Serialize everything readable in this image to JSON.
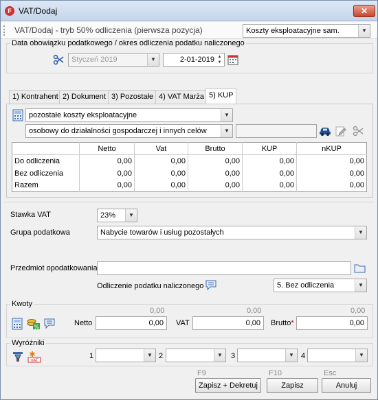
{
  "window": {
    "title": "VAT/Dodaj",
    "close_label": "✕"
  },
  "header": {
    "mode_text": "VAT/Dodaj - tryb 50% odliczenia (pierwsza pozycja)",
    "category_value": "Koszty eksploatacyjne sam."
  },
  "period": {
    "group_title": "Data obowiązku podatkowego / okres odliczenia podatku naliczonego",
    "month_value": "Styczeń 2019",
    "date_value": "2-01-2019"
  },
  "tabs": [
    {
      "label": "1) Kontrahent"
    },
    {
      "label": "2) Dokument"
    },
    {
      "label": "3) Pozostałe"
    },
    {
      "label": "4) VAT Marża"
    },
    {
      "label": "5) KUP"
    }
  ],
  "kup": {
    "category_value": "pozostałe koszty eksploatacyjne",
    "vehicle_type_value": "osobowy do działalności gospodarczej i innych celów",
    "vehicle_field_value": "",
    "grid": {
      "headers": [
        "",
        "Netto",
        "Vat",
        "Brutto",
        "KUP",
        "nKUP"
      ],
      "rows": [
        {
          "label": "Do odliczenia",
          "values": [
            "0,00",
            "0,00",
            "0,00",
            "0,00",
            "0,00"
          ]
        },
        {
          "label": "Bez odliczenia",
          "values": [
            "0,00",
            "0,00",
            "0,00",
            "0,00",
            "0,00"
          ]
        },
        {
          "label": "Razem",
          "values": [
            "0,00",
            "0,00",
            "0,00",
            "0,00",
            "0,00"
          ]
        }
      ]
    }
  },
  "vat": {
    "stawka_label": "Stawka VAT",
    "stawka_value": "23%",
    "grupa_label": "Grupa podatkowa",
    "grupa_value": "Nabycie towarów i usług pozostałych",
    "przedmiot_label": "Przedmiot opodatkowania",
    "przedmiot_value": "",
    "odliczenie_label": "Odliczenie podatku naliczonego",
    "odliczenie_value": "5. Bez odliczenia"
  },
  "kwoty": {
    "group_title": "Kwoty",
    "netto_label": "Netto",
    "vat_label": "VAT",
    "brutto_label": "Brutto",
    "required_mark": "*",
    "netto_hint": "0,00",
    "vat_hint": "0,00",
    "brutto_hint": "0,00",
    "netto_value": "0,00",
    "vat_value": "0,00",
    "brutto_value": "0,00"
  },
  "wyrozniki": {
    "group_title": "Wyróżniki",
    "slots": [
      {
        "label": "1",
        "value": ""
      },
      {
        "label": "2",
        "value": ""
      },
      {
        "label": "3",
        "value": ""
      },
      {
        "label": "4",
        "value": ""
      }
    ]
  },
  "footer": {
    "save_decree_shortcut": "F9",
    "save_decree_label": "Zapisz + Dekretuj",
    "save_shortcut": "F10",
    "save_label": "Zapisz",
    "cancel_shortcut": "Esc",
    "cancel_label": "Anuluj"
  },
  "icons": {
    "app": "f-logo-icon",
    "scissors": "scissors-icon",
    "calendar": "calendar-icon",
    "calculator": "calculator-icon",
    "car": "car-icon",
    "edit": "edit-document-icon",
    "comment": "comment-icon",
    "folder": "folder-icon",
    "percent": "percent-coins-icon",
    "highlighter": "highlighter-icon",
    "vat_star": "vat-star-icon"
  },
  "colors": {
    "accent": "#d3322f",
    "car_blue": "#1f4f8f"
  }
}
